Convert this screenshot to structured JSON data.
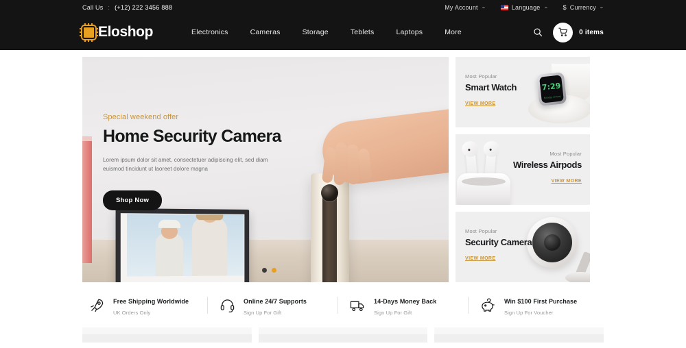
{
  "topbar": {
    "call_label": "Call Us",
    "separator": ":",
    "phone": "(+12) 222 3456 888",
    "account": "My Account",
    "language": "Language",
    "currency_symbol": "$",
    "currency": "Currency",
    "caret": "⌄"
  },
  "header": {
    "logo_text": "Eloshop",
    "nav": [
      {
        "label": "Electronics"
      },
      {
        "label": "Cameras"
      },
      {
        "label": "Storage"
      },
      {
        "label": "Teblets"
      },
      {
        "label": "Laptops"
      },
      {
        "label": "More"
      }
    ],
    "cart_items": "0 items"
  },
  "hero": {
    "eyebrow": "Special weekend offer",
    "title": "Home Security Camera",
    "description": "Lorem ipsum dolor sit amet, consectetuer adipiscing elit, sed diam euismod tincidunt ut laoreet dolore magna",
    "button": "Shop Now"
  },
  "cards": [
    {
      "kicker": "Most Popular",
      "title": "Smart Watch",
      "link": "VIEW MORE",
      "watch_time": "7:29",
      "watch_sub": "Monday 20 May"
    },
    {
      "kicker": "Most Popular",
      "title": "Wireless Airpods",
      "link": "VIEW MORE"
    },
    {
      "kicker": "Most Popular",
      "title": "Security Camera",
      "link": "VIEW MORE"
    }
  ],
  "features": [
    {
      "icon": "rocket-icon",
      "title": "Free Shipping Worldwide",
      "sub": "UK Orders Only"
    },
    {
      "icon": "headset-icon",
      "title": "Online 24/7 Supports",
      "sub": "Sign Up For Gift"
    },
    {
      "icon": "truck-icon",
      "title": "14-Days Money Back",
      "sub": "Sign Up For Gift"
    },
    {
      "icon": "piggy-bank-icon",
      "title": "Win $100 First Purchase",
      "sub": "Sign Up For Voucher"
    }
  ],
  "colors": {
    "accent": "#e8a020",
    "link": "#c9963e",
    "dark": "#141414",
    "card_bg": "#f0efef"
  }
}
